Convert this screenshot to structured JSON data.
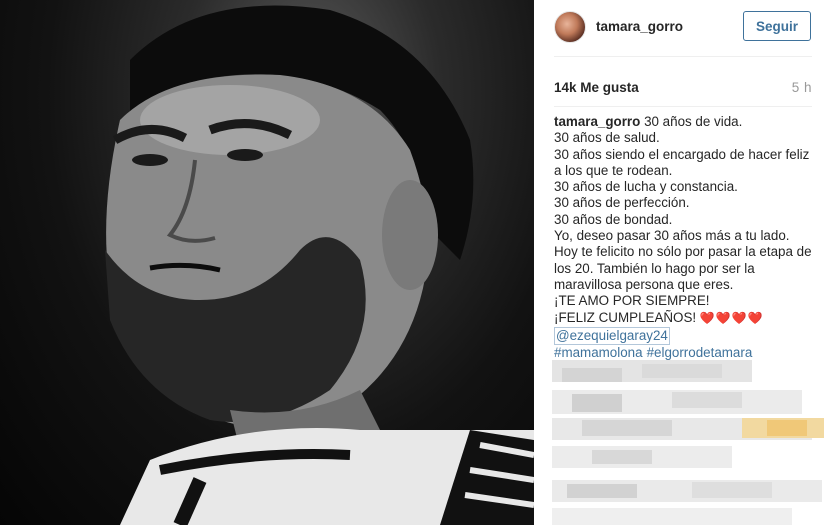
{
  "post": {
    "username": "tamara_gorro",
    "follow_label": "Seguir",
    "likes": "14k Me gusta",
    "time_ago": "5 h",
    "caption": {
      "author": "tamara_gorro",
      "lines": [
        "30 años de vida.",
        "30 años de salud.",
        "30 años siendo el encargado de hacer feliz",
        "a los que te rodean.",
        "30 años de lucha y constancia.",
        "30 años de perfección.",
        "30 años de bondad.",
        "Yo, deseo pasar 30 años más a tu lado.",
        "Hoy te felicito no sólo por pasar la etapa de",
        "los 20. También lo hago por ser la",
        "maravillosa persona que eres.",
        "¡TE AMO POR SIEMPRE!",
        "¡FELIZ CUMPLEAÑOS!"
      ],
      "hearts": "❤️❤️❤️❤️",
      "mention": "@ezequielgaray24",
      "hashtags": [
        "#mamamolona",
        "#elgorrodetamara"
      ]
    }
  },
  "icons": {
    "avatar": "profile-photo-avatar",
    "photo": "black-and-white-portrait-photo"
  },
  "colors": {
    "link": "#3f729b",
    "heart": "#e0282f",
    "muted": "#999999"
  }
}
